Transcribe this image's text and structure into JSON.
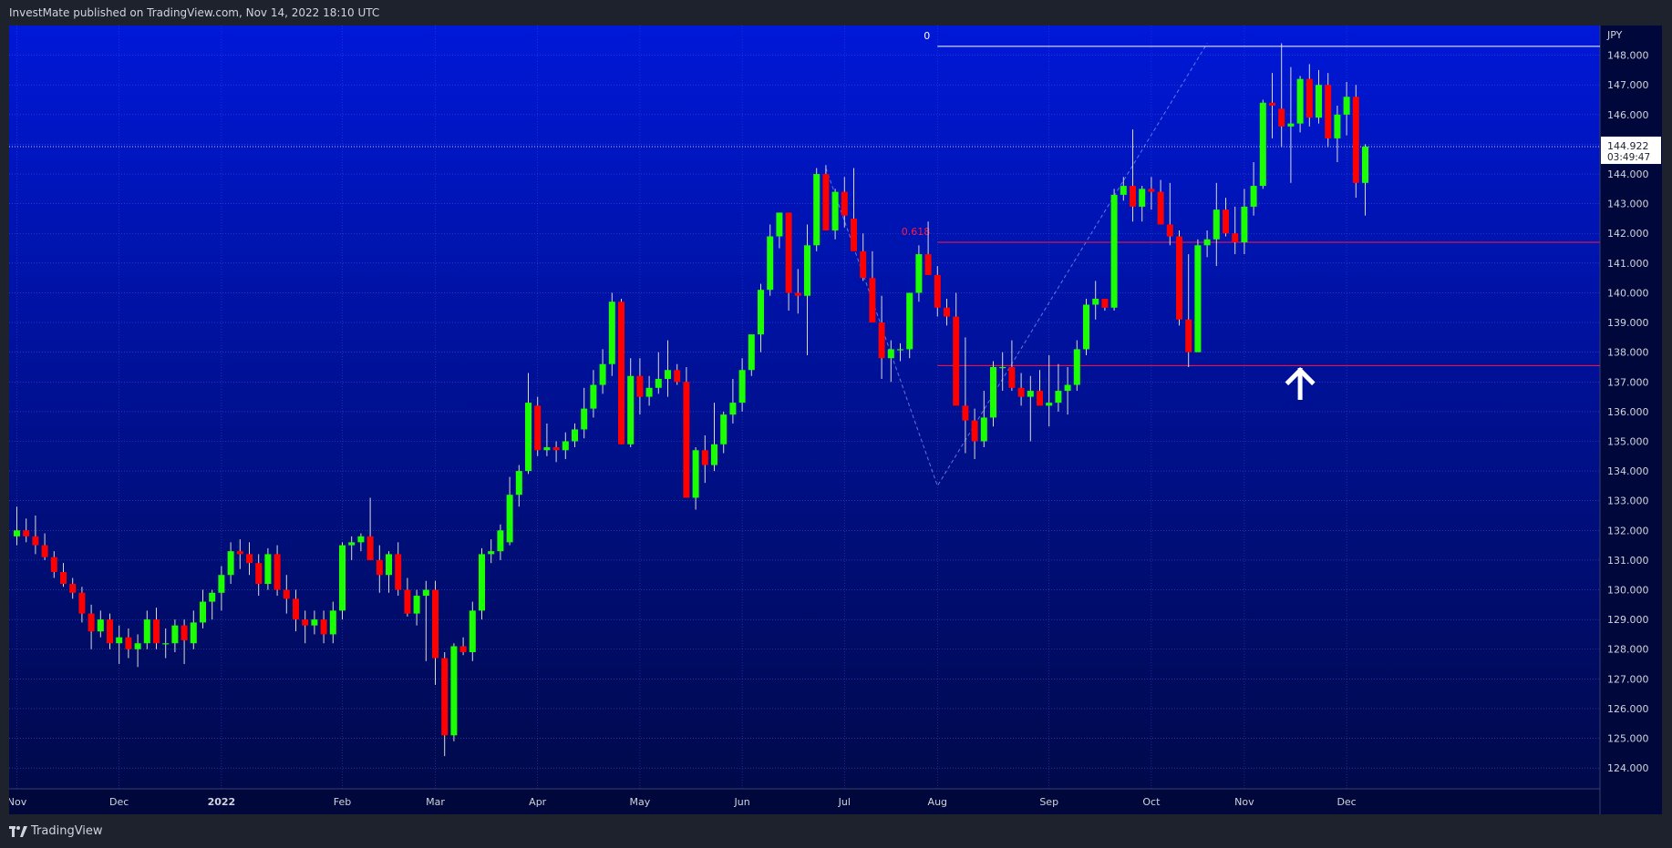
{
  "header": {
    "published_text": "InvestMate published on TradingView.com, Nov 14, 2022 18:10 UTC"
  },
  "footer": {
    "brand": "TradingView"
  },
  "chart_data": {
    "type": "candlestick",
    "currency_label": "JPY",
    "ylim": [
      123.3,
      149.0
    ],
    "y_ticks": [
      "124.000",
      "125.000",
      "126.000",
      "127.000",
      "128.000",
      "129.000",
      "130.000",
      "131.000",
      "132.000",
      "133.000",
      "134.000",
      "135.000",
      "136.000",
      "137.000",
      "138.000",
      "139.000",
      "140.000",
      "141.000",
      "142.000",
      "143.000",
      "144.000",
      "145.000",
      "146.000",
      "147.000",
      "148.000"
    ],
    "x_labels": [
      {
        "label": "Nov",
        "i": 0
      },
      {
        "label": "Dec",
        "i": 11
      },
      {
        "label": "2022",
        "i": 22
      },
      {
        "label": "Feb",
        "i": 35
      },
      {
        "label": "Mar",
        "i": 45
      },
      {
        "label": "Apr",
        "i": 56
      },
      {
        "label": "May",
        "i": 67
      },
      {
        "label": "Jun",
        "i": 78
      },
      {
        "label": "Jul",
        "i": 89
      },
      {
        "label": "Aug",
        "i": 99
      },
      {
        "label": "Sep",
        "i": 111
      },
      {
        "label": "Oct",
        "i": 122
      },
      {
        "label": "Nov",
        "i": 132
      },
      {
        "label": "Dec",
        "i": 143
      }
    ],
    "last_price": "144.922",
    "countdown": "03:49:47",
    "fib_levels": [
      {
        "label": "0",
        "value": 148.3,
        "color": "#ffffff",
        "start_i": 99
      },
      {
        "label": "0.618",
        "value": 141.7,
        "color": "#ff1744",
        "start_i": 99
      }
    ],
    "hlines": [
      {
        "value": 137.55,
        "color": "#ff1744",
        "start_i": 99
      }
    ],
    "zigzag": [
      [
        87,
        144.2
      ],
      [
        99,
        133.5
      ],
      [
        128,
        148.4
      ]
    ],
    "arrow_at": {
      "i": 138,
      "value": 136.9
    },
    "candles": [
      [
        131.8,
        132.8,
        131.5,
        132.0
      ],
      [
        132.0,
        132.4,
        131.6,
        131.8
      ],
      [
        131.8,
        132.5,
        131.2,
        131.5
      ],
      [
        131.5,
        131.9,
        131.0,
        131.1
      ],
      [
        131.1,
        131.3,
        130.4,
        130.6
      ],
      [
        130.6,
        130.9,
        130.1,
        130.2
      ],
      [
        130.2,
        130.4,
        129.7,
        129.9
      ],
      [
        129.9,
        130.1,
        128.9,
        129.2
      ],
      [
        129.2,
        129.5,
        128.0,
        128.6
      ],
      [
        128.6,
        129.3,
        128.4,
        129.0
      ],
      [
        129.0,
        129.2,
        128.0,
        128.2
      ],
      [
        128.2,
        128.8,
        127.5,
        128.4
      ],
      [
        128.4,
        128.7,
        127.7,
        128.0
      ],
      [
        128.0,
        128.5,
        127.4,
        128.2
      ],
      [
        128.2,
        129.3,
        128.0,
        129.0
      ],
      [
        129.0,
        129.4,
        128.0,
        128.2
      ],
      [
        128.2,
        128.7,
        127.7,
        128.2
      ],
      [
        128.2,
        129.0,
        127.9,
        128.8
      ],
      [
        128.8,
        129.0,
        127.5,
        128.3
      ],
      [
        128.2,
        129.3,
        128.0,
        128.9
      ],
      [
        128.9,
        130.0,
        128.7,
        129.6
      ],
      [
        129.6,
        130.0,
        129.0,
        129.9
      ],
      [
        129.9,
        130.8,
        129.3,
        130.5
      ],
      [
        130.5,
        131.6,
        130.2,
        131.3
      ],
      [
        131.3,
        131.7,
        130.7,
        131.2
      ],
      [
        131.2,
        131.6,
        130.5,
        130.9
      ],
      [
        130.9,
        131.2,
        129.8,
        130.2
      ],
      [
        130.2,
        131.4,
        130.0,
        131.2
      ],
      [
        131.2,
        131.5,
        129.8,
        130.0
      ],
      [
        130.0,
        130.5,
        129.2,
        129.7
      ],
      [
        129.7,
        130.0,
        128.6,
        129.0
      ],
      [
        129.0,
        129.3,
        128.2,
        128.8
      ],
      [
        128.8,
        129.3,
        128.5,
        129.0
      ],
      [
        129.0,
        129.3,
        128.2,
        128.5
      ],
      [
        128.5,
        129.6,
        128.2,
        129.3
      ],
      [
        129.3,
        131.6,
        129.0,
        131.5
      ],
      [
        131.5,
        131.8,
        131.0,
        131.6
      ],
      [
        131.6,
        131.9,
        131.3,
        131.8
      ],
      [
        131.8,
        133.1,
        131.4,
        131.0
      ],
      [
        131.0,
        131.5,
        129.9,
        130.5
      ],
      [
        130.5,
        131.3,
        129.9,
        131.2
      ],
      [
        131.2,
        131.6,
        129.8,
        130.0
      ],
      [
        130.0,
        130.4,
        129.1,
        129.2
      ],
      [
        129.2,
        130.0,
        128.8,
        129.8
      ],
      [
        129.8,
        130.3,
        127.6,
        130.0
      ],
      [
        130.0,
        130.3,
        126.8,
        127.7
      ],
      [
        127.7,
        127.9,
        124.4,
        125.1
      ],
      [
        125.1,
        128.2,
        124.9,
        128.1
      ],
      [
        128.1,
        128.4,
        127.8,
        127.9
      ],
      [
        127.9,
        129.6,
        127.6,
        129.3
      ],
      [
        129.3,
        131.4,
        129.0,
        131.2
      ],
      [
        131.2,
        131.7,
        130.9,
        131.3
      ],
      [
        131.3,
        132.2,
        131.0,
        132.0
      ],
      [
        131.6,
        133.8,
        131.5,
        133.2
      ],
      [
        133.2,
        134.2,
        132.8,
        134.0
      ],
      [
        134.0,
        137.3,
        133.9,
        136.3
      ],
      [
        136.2,
        136.5,
        134.5,
        134.7
      ],
      [
        134.7,
        135.6,
        134.5,
        134.8
      ],
      [
        134.8,
        135.0,
        134.3,
        134.7
      ],
      [
        134.7,
        135.3,
        134.4,
        135.0
      ],
      [
        135.0,
        135.6,
        134.8,
        135.4
      ],
      [
        135.4,
        136.8,
        135.1,
        136.1
      ],
      [
        136.1,
        137.4,
        135.8,
        136.9
      ],
      [
        136.9,
        138.1,
        136.6,
        137.6
      ],
      [
        137.6,
        140.0,
        137.2,
        139.7
      ],
      [
        139.7,
        139.8,
        134.9,
        134.9
      ],
      [
        134.9,
        137.8,
        134.8,
        137.2
      ],
      [
        137.2,
        137.8,
        135.9,
        136.5
      ],
      [
        136.5,
        137.2,
        136.2,
        136.8
      ],
      [
        136.8,
        138.0,
        136.6,
        137.1
      ],
      [
        137.1,
        138.4,
        136.5,
        137.4
      ],
      [
        137.4,
        137.6,
        136.9,
        137.0
      ],
      [
        137.0,
        137.5,
        133.6,
        133.1
      ],
      [
        133.1,
        134.8,
        132.7,
        134.7
      ],
      [
        134.7,
        135.2,
        133.6,
        134.2
      ],
      [
        134.2,
        136.3,
        134.0,
        134.9
      ],
      [
        134.9,
        136.0,
        134.6,
        135.9
      ],
      [
        135.9,
        137.1,
        135.6,
        136.3
      ],
      [
        136.3,
        137.8,
        136.0,
        137.4
      ],
      [
        137.4,
        138.5,
        137.2,
        138.6
      ],
      [
        138.6,
        140.3,
        138.0,
        140.1
      ],
      [
        140.1,
        142.3,
        139.9,
        141.9
      ],
      [
        141.9,
        142.7,
        141.5,
        142.7
      ],
      [
        142.7,
        142.7,
        139.4,
        140.0
      ],
      [
        140.0,
        140.8,
        139.3,
        139.9
      ],
      [
        139.9,
        142.3,
        137.9,
        141.6
      ],
      [
        141.6,
        144.2,
        141.4,
        144.0
      ],
      [
        144.0,
        144.3,
        142.1,
        142.1
      ],
      [
        142.1,
        143.5,
        141.8,
        143.4
      ],
      [
        143.4,
        143.9,
        142.2,
        142.6
      ],
      [
        142.5,
        144.2,
        141.8,
        141.4
      ],
      [
        141.4,
        142.0,
        140.4,
        140.5
      ],
      [
        140.5,
        141.4,
        139.9,
        139.0
      ],
      [
        139.0,
        139.9,
        137.1,
        137.8
      ],
      [
        137.8,
        138.4,
        137.0,
        138.1
      ],
      [
        138.1,
        138.3,
        137.7,
        138.1
      ],
      [
        138.1,
        140.0,
        137.8,
        140.0
      ],
      [
        140.0,
        141.6,
        139.7,
        141.3
      ],
      [
        141.3,
        142.4,
        140.8,
        140.6
      ],
      [
        140.6,
        140.9,
        139.2,
        139.5
      ],
      [
        139.5,
        139.8,
        138.9,
        139.2
      ],
      [
        139.2,
        140.0,
        137.0,
        136.2
      ],
      [
        136.2,
        138.5,
        134.6,
        135.7
      ],
      [
        135.7,
        136.1,
        134.4,
        135.0
      ],
      [
        135.0,
        136.7,
        134.8,
        135.8
      ],
      [
        135.8,
        137.7,
        135.5,
        137.5
      ],
      [
        137.5,
        138.0,
        136.7,
        137.5
      ],
      [
        137.5,
        138.4,
        136.7,
        136.8
      ],
      [
        136.8,
        137.3,
        136.2,
        136.5
      ],
      [
        136.5,
        137.2,
        135.0,
        136.7
      ],
      [
        136.7,
        137.4,
        136.3,
        136.2
      ],
      [
        136.2,
        137.9,
        135.5,
        136.3
      ],
      [
        136.3,
        137.6,
        136.0,
        136.7
      ],
      [
        136.7,
        137.5,
        135.9,
        136.9
      ],
      [
        136.9,
        138.4,
        136.7,
        138.1
      ],
      [
        138.1,
        139.8,
        137.9,
        139.6
      ],
      [
        139.6,
        140.4,
        139.1,
        139.8
      ],
      [
        139.8,
        139.8,
        139.4,
        139.5
      ],
      [
        139.5,
        143.5,
        139.4,
        143.3
      ],
      [
        143.3,
        143.9,
        143.1,
        143.6
      ],
      [
        143.6,
        145.5,
        142.4,
        142.9
      ],
      [
        142.9,
        143.6,
        142.4,
        143.5
      ],
      [
        143.5,
        143.9,
        142.8,
        143.4
      ],
      [
        143.4,
        143.8,
        142.3,
        142.3
      ],
      [
        142.3,
        143.7,
        141.6,
        141.9
      ],
      [
        141.9,
        142.1,
        138.9,
        139.1
      ],
      [
        139.1,
        141.3,
        137.5,
        138.0
      ],
      [
        138.0,
        141.8,
        138.3,
        141.6
      ],
      [
        141.6,
        142.1,
        141.2,
        141.8
      ],
      [
        141.8,
        143.7,
        140.9,
        142.8
      ],
      [
        142.8,
        143.2,
        141.9,
        142.0
      ],
      [
        142.0,
        142.9,
        141.3,
        141.7
      ],
      [
        141.7,
        143.5,
        141.3,
        142.9
      ],
      [
        142.9,
        144.4,
        142.6,
        143.6
      ],
      [
        143.6,
        146.5,
        143.5,
        146.4
      ],
      [
        146.4,
        147.4,
        145.2,
        146.3
      ],
      [
        146.2,
        148.4,
        144.9,
        145.6
      ],
      [
        145.6,
        147.6,
        143.7,
        145.7
      ],
      [
        145.7,
        147.3,
        145.4,
        147.2
      ],
      [
        147.2,
        147.7,
        145.6,
        145.9
      ],
      [
        145.9,
        147.5,
        145.7,
        147.0
      ],
      [
        147.0,
        147.4,
        144.9,
        145.2
      ],
      [
        145.2,
        146.3,
        144.4,
        146.0
      ],
      [
        146.0,
        147.1,
        145.3,
        146.6
      ],
      [
        146.6,
        147.0,
        143.2,
        143.7
      ],
      [
        143.7,
        145.0,
        142.6,
        144.922
      ]
    ]
  }
}
